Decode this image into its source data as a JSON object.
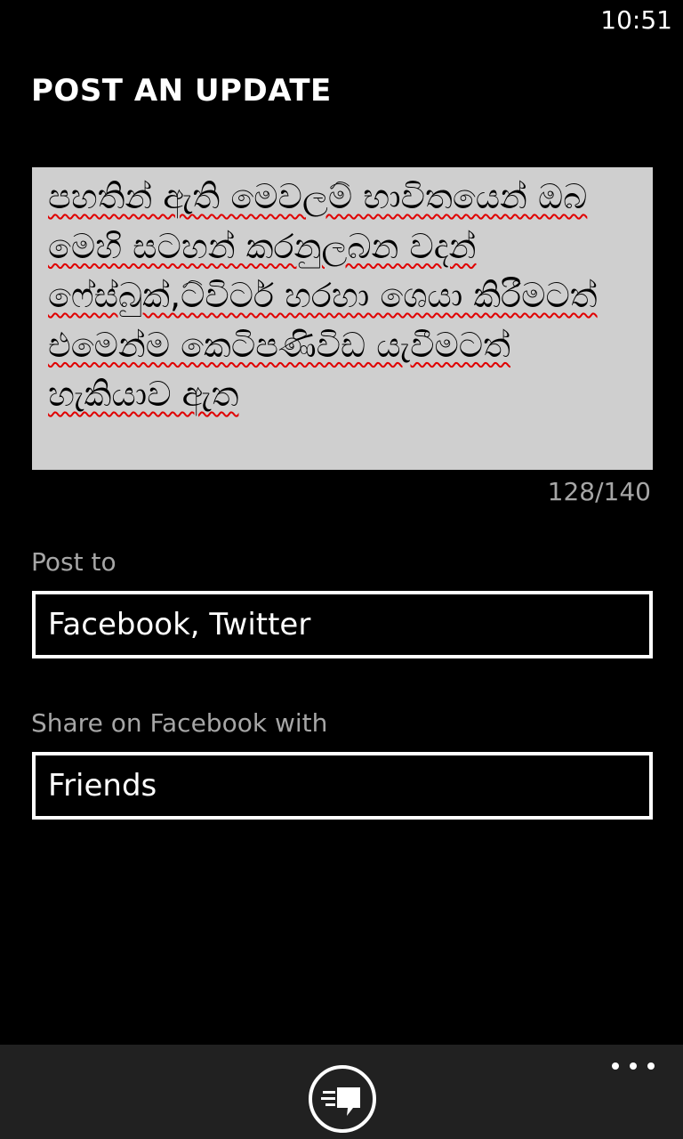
{
  "status_bar": {
    "time": "10:51"
  },
  "page": {
    "title": "POST AN UPDATE"
  },
  "compose": {
    "text": "පහතින් ඇති මෙවලම් භාවිතයෙන් ඔබ මෙහි සටහන් කරනුලබන වදන් ෆේස්බුක්,ට්විටර් හරහා ශෙයා කිරීමටත් එමෙන්ම කෙටිපණිවිඩ යැවීමටත් හැකියාව ඇත",
    "char_count": "128/140"
  },
  "post_to": {
    "label": "Post to",
    "value": "Facebook, Twitter"
  },
  "share_with": {
    "label": "Share on Facebook with",
    "value": "Friends"
  },
  "app_bar": {
    "post_icon": "post-message-icon",
    "more_icon": "ellipsis-icon"
  }
}
